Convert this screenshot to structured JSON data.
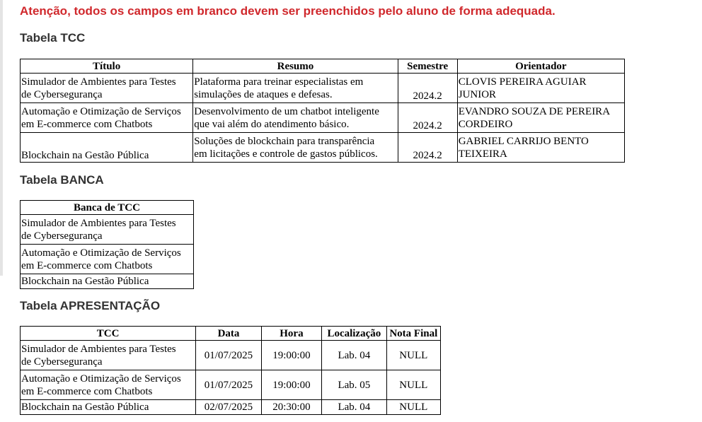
{
  "warning": "Atenção, todos os campos em branco devem ser preenchidos pelo aluno de forma adequada.",
  "tcc": {
    "heading": "Tabela TCC",
    "headers": [
      "Título",
      "Resumo",
      "Semestre",
      "Orientador"
    ],
    "rows": [
      {
        "titulo": [
          "Simulador de Ambientes para Testes",
          "de Cybersegurança"
        ],
        "resumo": [
          "Plataforma para treinar especialistas em",
          "simulações de ataques e defesas."
        ],
        "semestre": "2024.2",
        "orientador": [
          "CLOVIS PEREIRA AGUIAR",
          "JUNIOR"
        ]
      },
      {
        "titulo": [
          "Automação e Otimização de Serviços",
          "em E-commerce com Chatbots"
        ],
        "resumo": [
          "Desenvolvimento de um chatbot inteligente",
          "que vai além do atendimento básico."
        ],
        "semestre": "2024.2",
        "orientador": [
          "EVANDRO SOUZA DE PEREIRA",
          "CORDEIRO"
        ]
      },
      {
        "titulo": [
          "Blockchain na Gestão Pública"
        ],
        "resumo": [
          "Soluções de blockchain para transparência",
          "em licitações e controle de gastos públicos."
        ],
        "semestre": "2024.2",
        "orientador": [
          "GABRIEL CARRIJO BENTO",
          "TEIXEIRA"
        ]
      }
    ]
  },
  "banca": {
    "heading": "Tabela BANCA",
    "header": "Banca de TCC",
    "rows": [
      [
        "Simulador de Ambientes para Testes",
        "de Cybersegurança"
      ],
      [
        "Automação e Otimização de Serviços",
        "em E-commerce com Chatbots"
      ],
      [
        "Blockchain na Gestão Pública"
      ]
    ]
  },
  "apresentacao": {
    "heading": "Tabela APRESENTAÇÃO",
    "headers": [
      "TCC",
      "Data",
      "Hora",
      "Localização",
      "Nota Final"
    ],
    "rows": [
      {
        "tcc": [
          "Simulador de Ambientes para Testes",
          "de Cybersegurança"
        ],
        "data": "01/07/2025",
        "hora": "19:00:00",
        "local": "Lab. 04",
        "nota": "NULL"
      },
      {
        "tcc": [
          "Automação e Otimização de Serviços",
          "em E-commerce com Chatbots"
        ],
        "data": "01/07/2025",
        "hora": "19:00:00",
        "local": "Lab. 05",
        "nota": "NULL"
      },
      {
        "tcc": [
          "Blockchain na Gestão Pública"
        ],
        "data": "02/07/2025",
        "hora": "20:30:00",
        "local": "Lab. 04",
        "nota": "NULL"
      }
    ]
  }
}
